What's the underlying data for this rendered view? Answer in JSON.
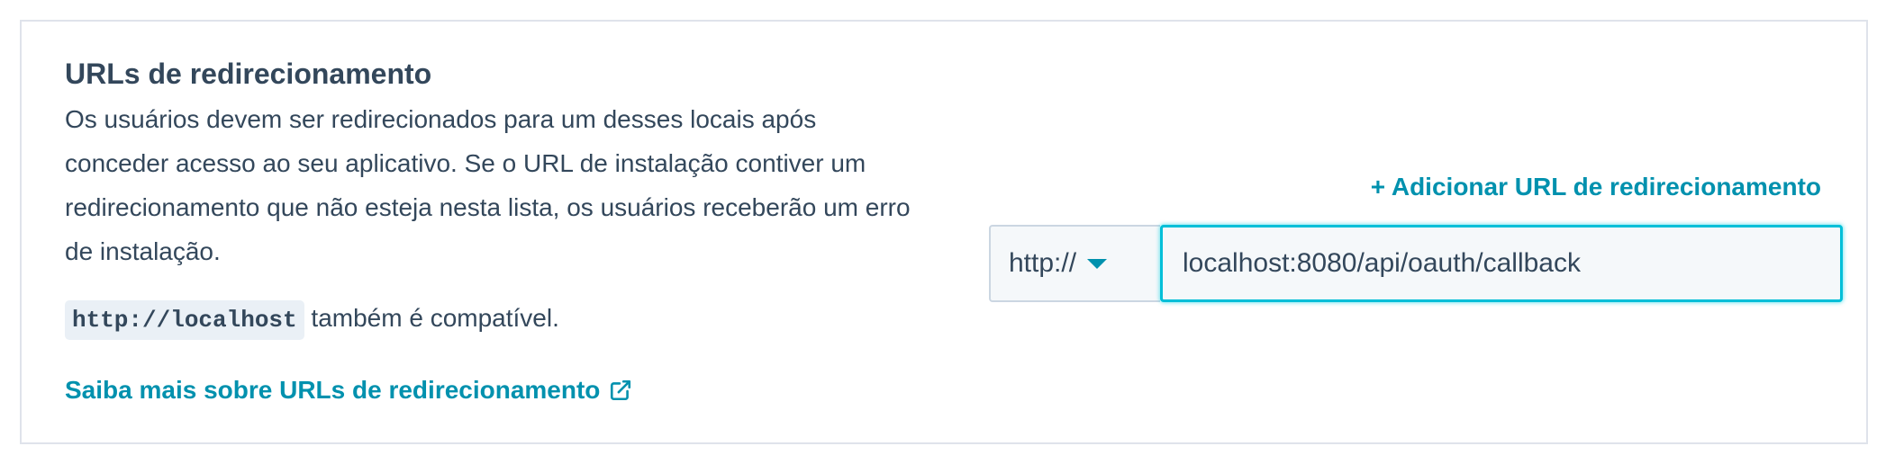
{
  "section": {
    "title": "URLs de redirecionamento",
    "description": "Os usuários devem ser redirecionados para um desses locais após conceder acesso ao seu aplicativo. Se o URL de instalação contiver um redirecionamento que não esteja nesta lista, os usuários receberão um erro de instalação.",
    "compat_code": "http://localhost",
    "compat_suffix": " também é compatível.",
    "learn_more_label": "Saiba mais sobre URLs de redirecionamento"
  },
  "redirect": {
    "add_label": "+ Adicionar URL de redirecionamento",
    "protocol": "http://",
    "url_value": "localhost:8080/api/oauth/callback"
  },
  "icons": {
    "learn_more": "external-link-icon",
    "protocol_caret": "caret-down-icon"
  },
  "colors": {
    "text": "#33475b",
    "link": "#0091ae",
    "border": "#dfe3eb",
    "focus": "#00bfd8",
    "code_bg": "#eaf0f6"
  }
}
